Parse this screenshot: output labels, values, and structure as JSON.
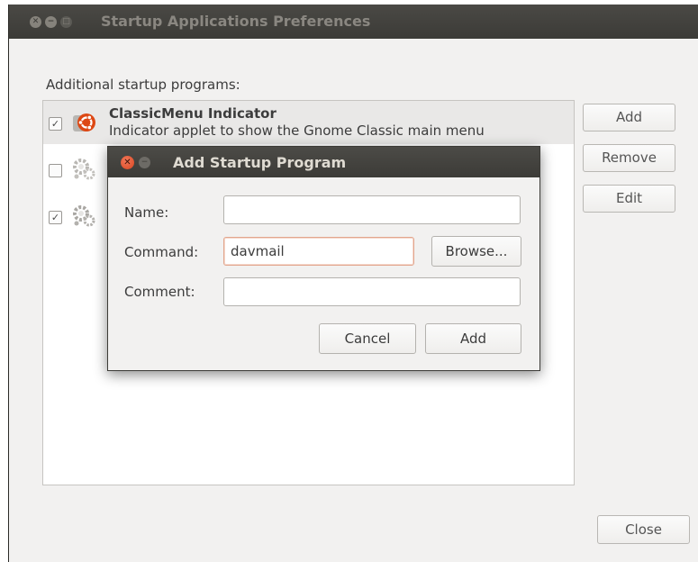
{
  "main_window": {
    "title": "Startup Applications Preferences",
    "titlebar_buttons": {
      "close": "✕",
      "minimize": "−",
      "maximize": "□"
    },
    "section_label": "Additional startup programs:",
    "programs": [
      {
        "checked": true,
        "title": "ClassicMenu Indicator",
        "description": "Indicator applet to show the Gnome Classic main menu",
        "icon": "ubuntu-logo-icon"
      },
      {
        "checked": false,
        "title": "",
        "description": "",
        "icon": "gears-icon"
      },
      {
        "checked": true,
        "title": "",
        "description": "",
        "icon": "gears-icon"
      }
    ],
    "checkmark": "✓",
    "buttons": {
      "add": "Add",
      "remove": "Remove",
      "edit": "Edit",
      "close": "Close"
    }
  },
  "dialog": {
    "title": "Add Startup Program",
    "titlebar_buttons": {
      "close": "✕",
      "minimize": "−"
    },
    "fields": {
      "name": {
        "label": "Name:",
        "value": ""
      },
      "command": {
        "label": "Command:",
        "value": "davmail"
      },
      "comment": {
        "label": "Comment:",
        "value": ""
      }
    },
    "buttons": {
      "browse": "Browse...",
      "cancel": "Cancel",
      "add": "Add"
    }
  },
  "colors": {
    "titlebar": "#3c3b37",
    "window_bg": "#f2f1f0",
    "close_accent": "#df4a16",
    "ubuntu_orange": "#dd4814"
  }
}
